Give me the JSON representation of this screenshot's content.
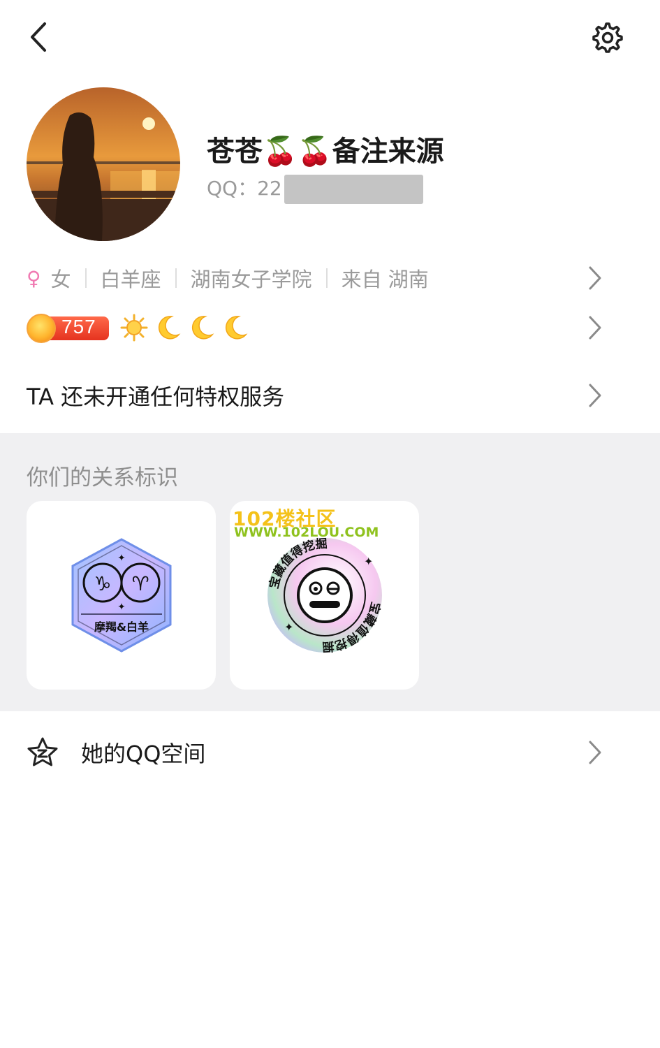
{
  "profile": {
    "name": "苍苍🍒🍒备注来源",
    "qq_label": "QQ：",
    "qq_partial": "22",
    "gender_symbol": "♀",
    "gender": "女",
    "zodiac": "白羊座",
    "school": "湖南女子学院",
    "hometown": "来自 湖南",
    "level": "757"
  },
  "privilege": {
    "text": "TA 还未开通任何特权服务"
  },
  "relationship": {
    "title": "你们的关系标识",
    "badges": [
      {
        "label": "摩羯&白羊"
      },
      {
        "ring_text": "宝藏值得挖掘",
        "watermark_line1": "102楼社区",
        "watermark_line2": "WWW.102LOU.COM"
      }
    ]
  },
  "qzone": {
    "label": "她的QQ空间"
  },
  "icons": {
    "back": "back-chevron-icon",
    "settings": "gear-icon",
    "chevron": "chevron-right-icon",
    "qzone": "star-z-icon"
  },
  "colors": {
    "gender": "#f07ab2",
    "level_badge": "#e5331f",
    "section_bg": "#f0f0f2",
    "watermark_yellow": "#f4c21a",
    "watermark_green": "#8fc21e"
  }
}
